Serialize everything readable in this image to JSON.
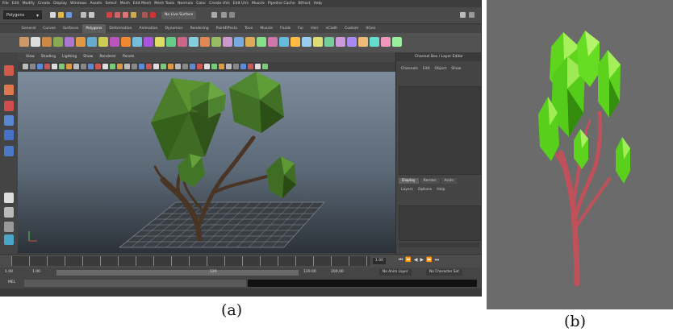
{
  "maya": {
    "menu": [
      "File",
      "Edit",
      "Modify",
      "Create",
      "Display",
      "Windows",
      "Assets",
      "Select",
      "Mesh",
      "Edit Mesh",
      "Mesh Tools",
      "Normals",
      "Color",
      "Create UVs",
      "Edit UVs",
      "Muscle",
      "Pipeline Cache",
      "Bifrost",
      "Help"
    ],
    "mode": "Polygons",
    "symmetry_button": "No Live Surface",
    "shelf_tabs": [
      "General",
      "Curves",
      "Surfaces",
      "Polygons",
      "Deformation",
      "Animation",
      "Dynamics",
      "Rendering",
      "PaintEffects",
      "Toon",
      "Muscle",
      "Fluids",
      "Fur",
      "Hair",
      "nCloth",
      "Custom",
      "XGen"
    ],
    "active_shelf_tab": "Polygons",
    "viewport_menu": [
      "View",
      "Shading",
      "Lighting",
      "Show",
      "Renderer",
      "Panels"
    ],
    "channel_box_title": "Channel Box / Layer Editor",
    "channel_menu": [
      "Channels",
      "Edit",
      "Object",
      "Show"
    ],
    "layer_tabs": [
      "Display",
      "Render",
      "Anim"
    ],
    "active_layer_tab": "Display",
    "layer_menu": [
      "Layers",
      "Options",
      "Help"
    ],
    "time_current": "1.00",
    "range_start": "1.00",
    "range_start2": "1.00",
    "range_mid": "120",
    "range_end": "120.00",
    "range_end2": "200.00",
    "anim_layer_dropdown": "No Anim Layer",
    "char_set_dropdown": "No Character Set",
    "mel_label": "MEL"
  },
  "colors": {
    "leaf_dark": "#3f6b24",
    "leaf_light": "#8cd23a",
    "trunk_maya": "#4a3524",
    "render_leaf": "#5fd51e",
    "render_trunk": "#c0505a"
  },
  "captions": {
    "a": "(a)",
    "b": "(b)"
  }
}
